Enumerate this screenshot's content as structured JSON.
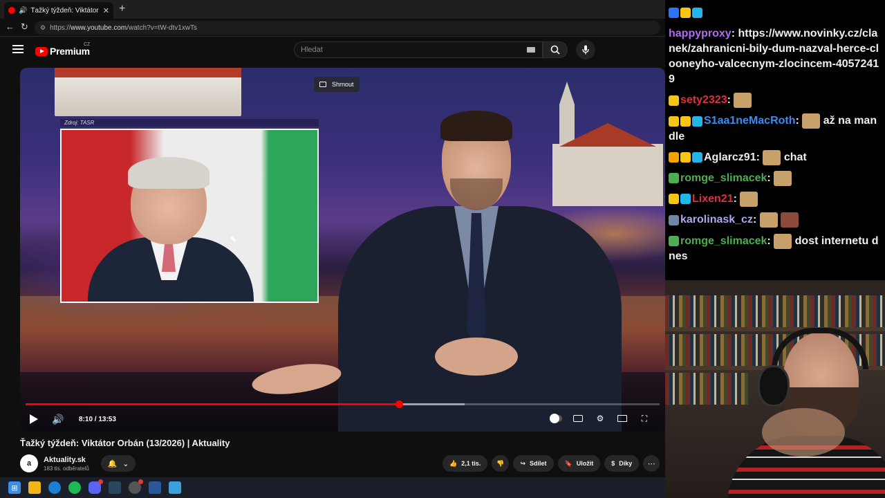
{
  "browser": {
    "tab_title": "Ťažký týždeň: Viktátor Orbán (",
    "url_prefix": "https://",
    "url_host": "www.youtube.com",
    "url_path": "/watch?v=tW-dtv1xwTs"
  },
  "youtube": {
    "logo_text": "Premium",
    "logo_country": "CZ",
    "search_placeholder": "Hledat"
  },
  "player": {
    "overlay_button": "Shrnout",
    "source_caption": "Zdroj: TASR",
    "time": "8:10 / 13:53",
    "progress_fraction": 0.589,
    "buffered_fraction": 0.693
  },
  "video": {
    "title": "Ťažký týždeň: Viktátor Orbán (13/2026) | Aktuality",
    "channel_name": "Aktuality.sk",
    "channel_avatar": "a",
    "subscribers": "183 tis. odběratelů"
  },
  "actions": {
    "likes": "2,1 tis.",
    "share": "Sdílet",
    "save": "Uložit",
    "thanks": "Díky"
  },
  "chat": [
    {
      "user": "",
      "text": "",
      "color": "#ffffff",
      "badges": [
        "#2b73ff",
        "#f5c518",
        "#23b5e8"
      ],
      "emotes": 0
    },
    {
      "user": "happyproxy",
      "text": "https://www.novinky.cz/clanek/zahranicni-bily-dum-nazval-herce-clooneyho-valcecnym-zlocincem-40572419",
      "color": "#b06cf2",
      "badges": [],
      "emotes": 0
    },
    {
      "user": "sety2323",
      "text": "",
      "color": "#e0303a",
      "badges": [
        "#f5c518"
      ],
      "emotes": 1
    },
    {
      "user": "S1aa1neMacRoth",
      "text": "až na mandle",
      "color": "#3b8cf0",
      "badges": [
        "#f5c518",
        "#f5c518",
        "#23b5e8"
      ],
      "emotes": 1
    },
    {
      "user": "Aglarcz91",
      "text": "chat",
      "color": "#eeeeee",
      "badges": [
        "#f5a300",
        "#f5c518",
        "#23b5e8"
      ],
      "emotes": 1
    },
    {
      "user": "romge_slimacek",
      "text": "",
      "color": "#4caf50",
      "badges": [
        "#4caf50"
      ],
      "emotes": 1
    },
    {
      "user": "Lixen21",
      "text": "",
      "color": "#e0303a",
      "badges": [
        "#f5c518",
        "#23b5e8"
      ],
      "emotes": 1
    },
    {
      "user": "karolinask_cz",
      "text": "",
      "color": "#aaaaee",
      "badges": [
        "#6c8aa8"
      ],
      "emotes": 2
    },
    {
      "user": "romge_slimacek",
      "text": "dost internetu dnes",
      "color": "#4caf50",
      "badges": [
        "#4caf50"
      ],
      "emotes": 1
    }
  ]
}
